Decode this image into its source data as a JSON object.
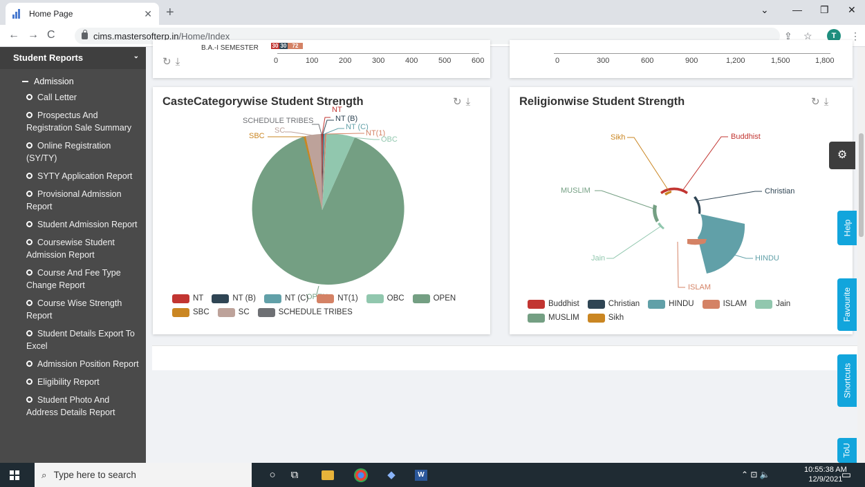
{
  "browser": {
    "tab_title": "Home Page",
    "url_host": "cims.mastersofterp.in",
    "url_path": "/Home/Index",
    "avatar_letter": "T"
  },
  "sidebar": {
    "header": "Student Reports",
    "sub_header": "Admission",
    "items": [
      "Call Letter",
      "Prospectus And Registration Sale Summary",
      "Online Registration (SY/TY)",
      "SYTY Application Report",
      "Provisional Admission Report",
      "Student Admission Report",
      "Coursewise Student Admission Report",
      "Course And Fee Type Change Report",
      "Course Wise Strength Report",
      "Student Details Export To Excel",
      "Admission Position Report",
      "Eligibility Report",
      "Student Photo And Address Details Report"
    ]
  },
  "top_left_chart": {
    "partial_label": "B.A.-I SEMESTER",
    "bar_labels": [
      "30",
      "30",
      "72"
    ],
    "ticks": [
      "0",
      "100",
      "200",
      "300",
      "400",
      "500",
      "600"
    ]
  },
  "top_right_chart": {
    "ticks": [
      "0",
      "300",
      "600",
      "900",
      "1,200",
      "1,500",
      "1,800"
    ]
  },
  "caste_card": {
    "title": "CasteCategorywise Student Strength",
    "pie_labels": [
      "NT",
      "NT (B)",
      "NT (C)",
      "NT(1)",
      "OBC",
      "SCHEDULE TRIBES",
      "SC",
      "SBC",
      "OPEN"
    ],
    "legend": [
      {
        "name": "NT",
        "color": "#c23531"
      },
      {
        "name": "NT (B)",
        "color": "#2f4554"
      },
      {
        "name": "NT (C)",
        "color": "#61a0a8"
      },
      {
        "name": "NT(1)",
        "color": "#d48265"
      },
      {
        "name": "OBC",
        "color": "#91c7ae"
      },
      {
        "name": "OPEN",
        "color": "#749f83"
      },
      {
        "name": "SBC",
        "color": "#ca8622"
      },
      {
        "name": "SC",
        "color": "#bda29a"
      },
      {
        "name": "SCHEDULE TRIBES",
        "color": "#6e7074"
      }
    ]
  },
  "religion_card": {
    "title": "Religionwise Student Strength",
    "labels": [
      "Buddhist",
      "Christian",
      "HINDU",
      "ISLAM",
      "Jain",
      "MUSLIM",
      "Sikh"
    ],
    "legend": [
      {
        "name": "Buddhist",
        "color": "#c23531"
      },
      {
        "name": "Christian",
        "color": "#2f4554"
      },
      {
        "name": "HINDU",
        "color": "#61a0a8"
      },
      {
        "name": "ISLAM",
        "color": "#d48265"
      },
      {
        "name": "Jain",
        "color": "#91c7ae"
      },
      {
        "name": "MUSLIM",
        "color": "#749f83"
      },
      {
        "name": "Sikh",
        "color": "#ca8622"
      }
    ]
  },
  "float_tabs": {
    "help": "Help",
    "favourite": "Favourite",
    "shortcuts": "Shortcuts",
    "tou": "ToU"
  },
  "taskbar": {
    "search_placeholder": "Type here to search",
    "time": "10:55:38 AM",
    "date": "12/9/2021"
  }
}
